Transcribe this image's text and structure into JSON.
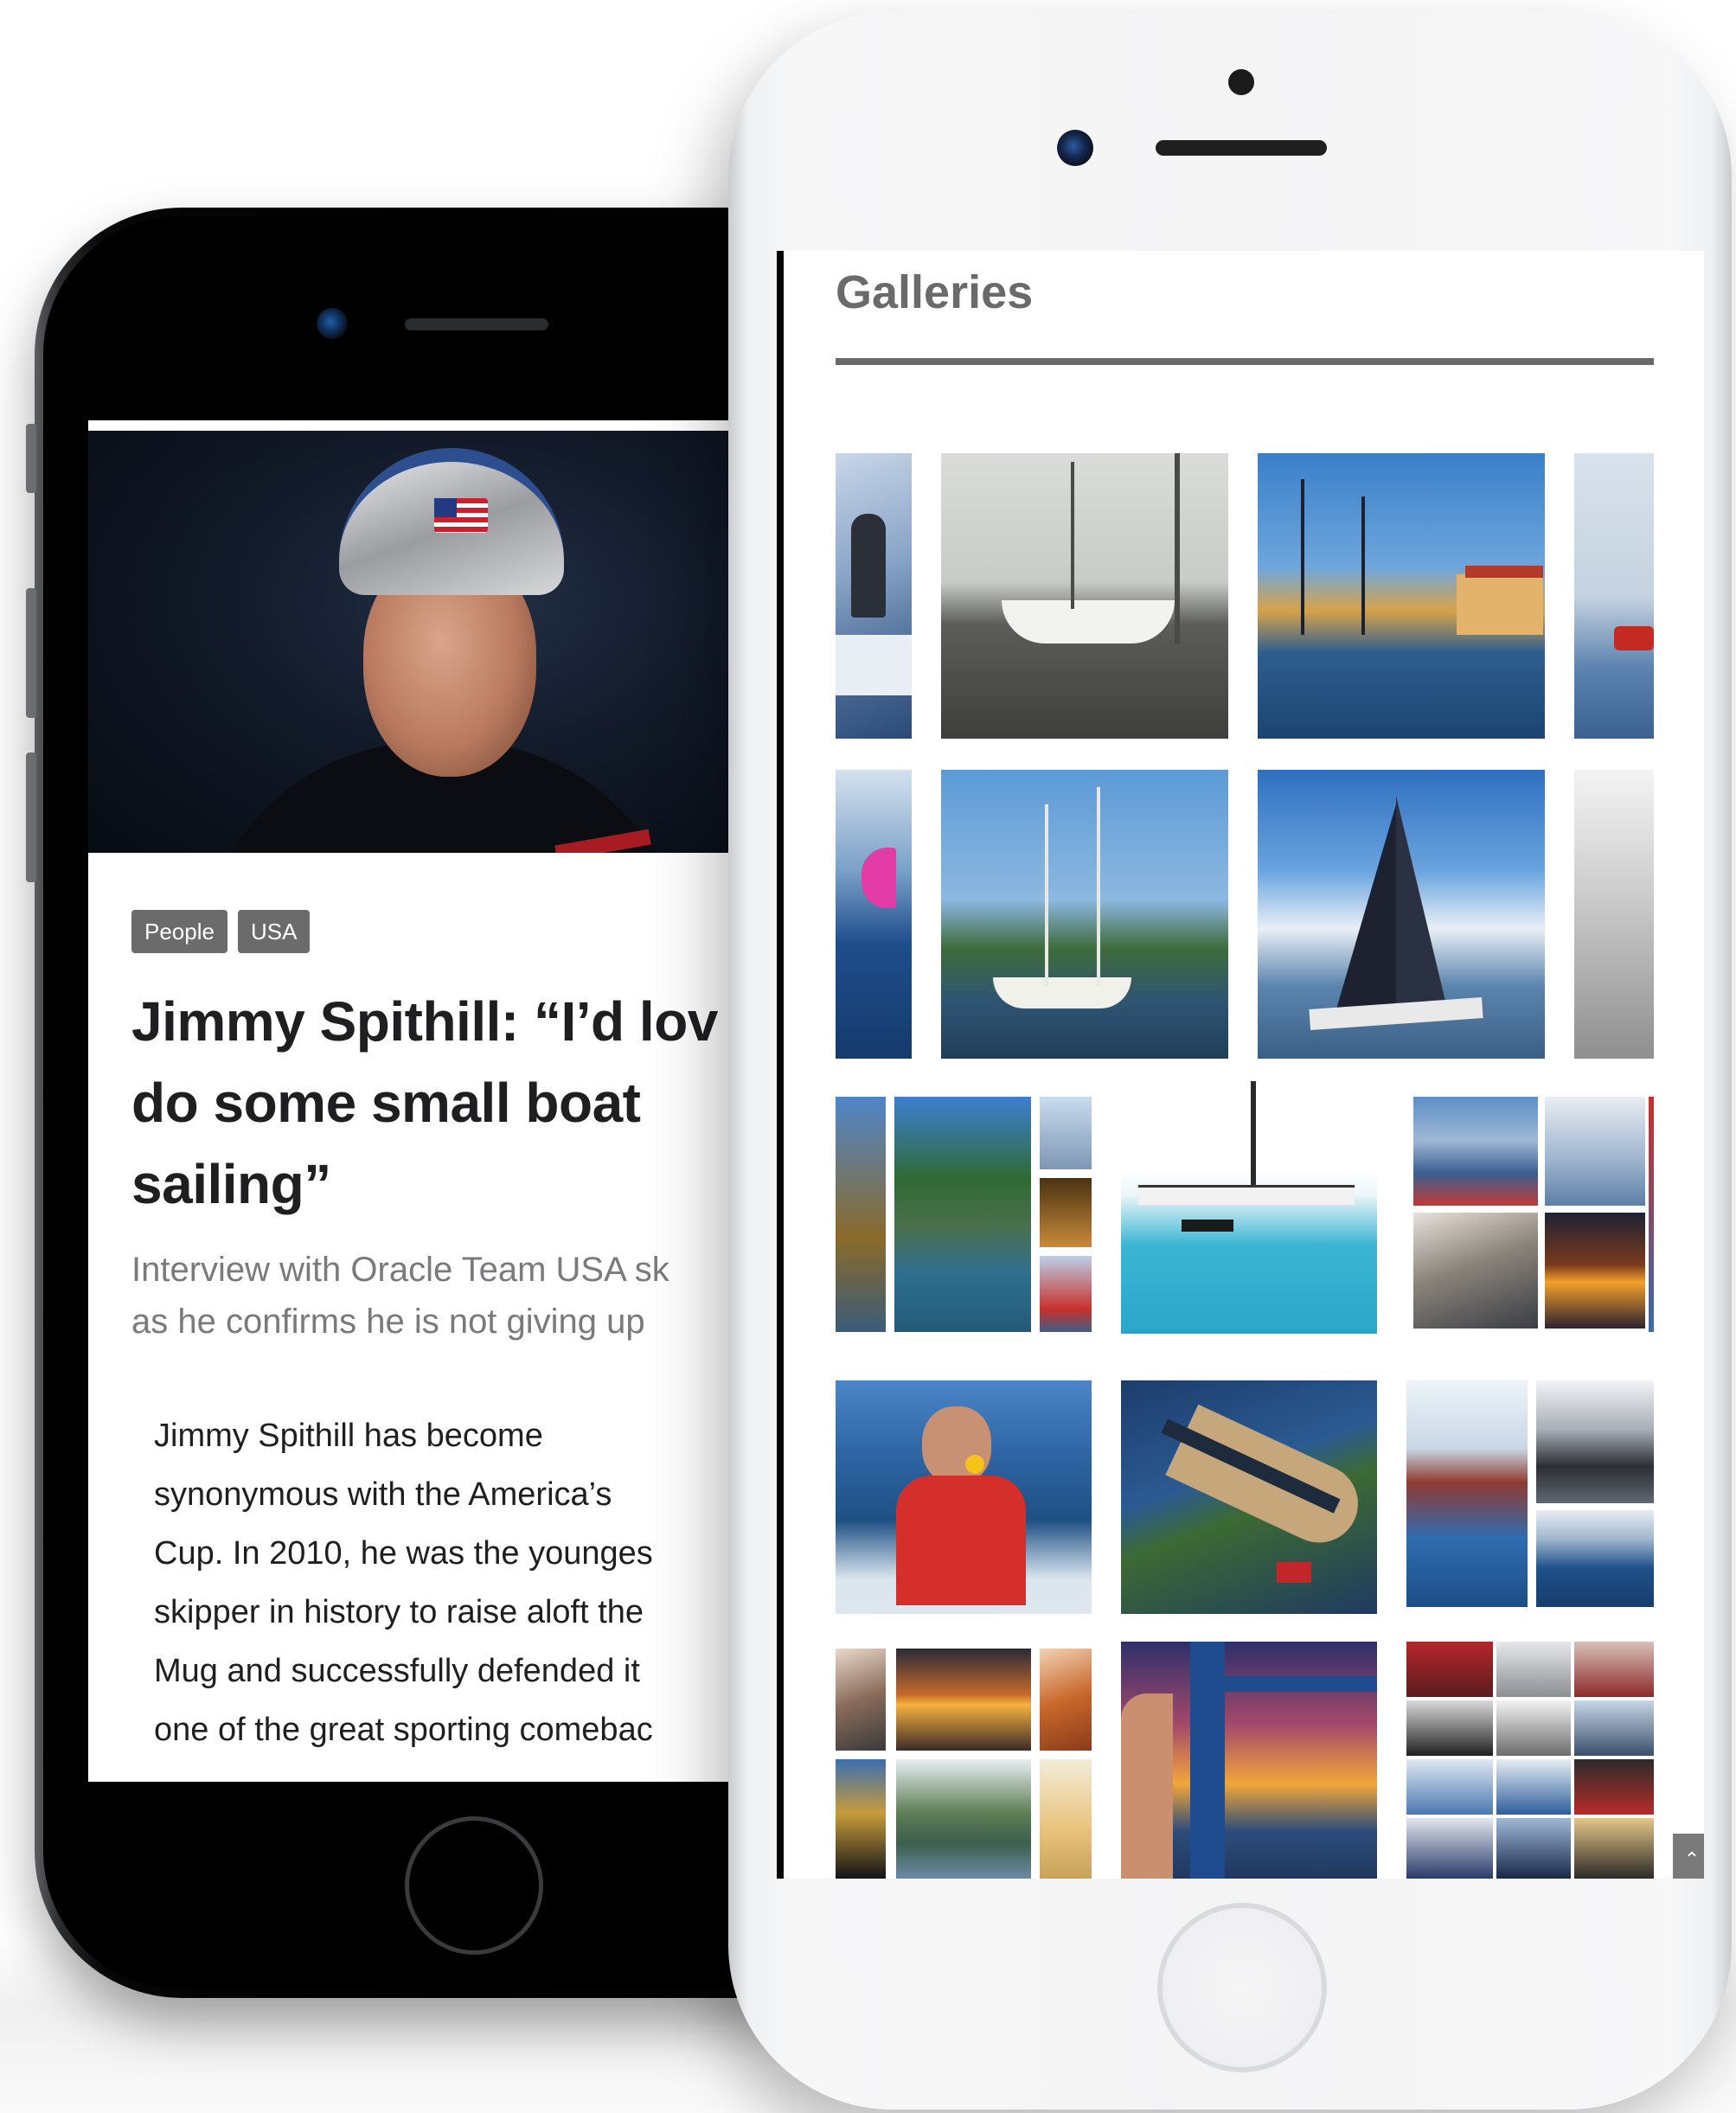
{
  "article": {
    "tags": [
      "People",
      "USA"
    ],
    "title": "Jimmy Spithill: “I’d lov\ndo some small boat\nsailing”",
    "subtitle": "Interview with Oracle Team USA sk\nas he confirms he is not giving up",
    "body": "Jimmy Spithill has become\nsynonymous with the America’s\nCup. In 2010, he was the younges\nskipper in history to raise aloft the\nMug and successfully defended it\none of the great sporting comebac"
  },
  "galleries": {
    "heading": "Galleries",
    "scroll_top_icon": "chevron-up-icon",
    "photos": [
      "sailing-crew",
      "boat-on-slipway",
      "harbor-sunset-masts",
      "red-catamaran",
      "wave-pink-sail",
      "marina-palm-trees",
      "yacht-heeling-sky",
      "grey-water",
      "collage-harbor",
      "blue-yacht-bow",
      "collage-sunsets",
      "sailor-red-gear",
      "superyacht-deck",
      "collage-racing",
      "collage-evening",
      "mast-sunset",
      "collage-regatta"
    ]
  },
  "colors": {
    "tag_bg": "#6b6b6b",
    "heading_grey": "#6a6a6a",
    "title_text": "#1f1f22",
    "subtitle_text": "#7a7a7e"
  }
}
